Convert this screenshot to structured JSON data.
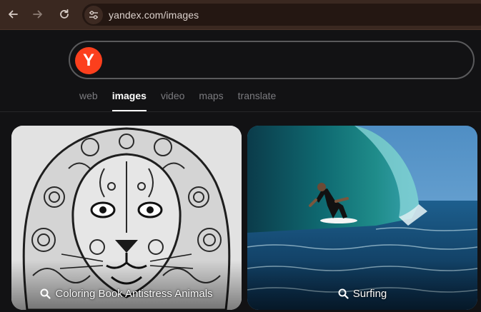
{
  "browser": {
    "url": "yandex.com/images",
    "icons": [
      "back-arrow-icon",
      "forward-arrow-icon",
      "reload-icon",
      "site-info-icon"
    ]
  },
  "search": {
    "logo_letter": "Y",
    "query": "",
    "brand_color": "#fc3f1d"
  },
  "tabs": [
    {
      "label": "web",
      "active": false
    },
    {
      "label": "images",
      "active": true
    },
    {
      "label": "video",
      "active": false
    },
    {
      "label": "maps",
      "active": false
    },
    {
      "label": "translate",
      "active": false
    }
  ],
  "results": [
    {
      "caption": "Coloring Book Antistress Animals",
      "icon": "search-icon"
    },
    {
      "caption": "Surfing",
      "icon": "search-icon"
    }
  ]
}
